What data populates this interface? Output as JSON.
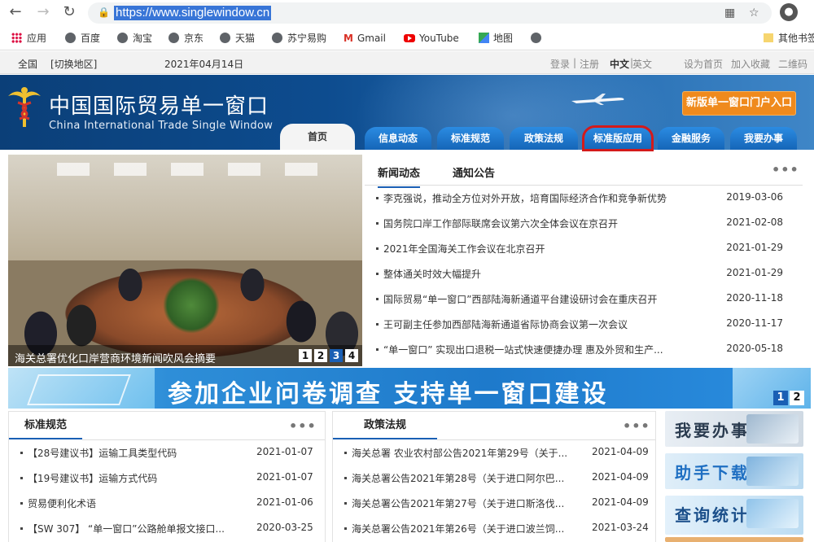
{
  "browser": {
    "url": "https://www.singlewindow.cn",
    "bookmarks": [
      {
        "label": "应用",
        "icon": "apps-grid-icon"
      },
      {
        "label": "百度",
        "icon": "globe-icon"
      },
      {
        "label": "淘宝",
        "icon": "globe-icon"
      },
      {
        "label": "京东",
        "icon": "globe-icon"
      },
      {
        "label": "天猫",
        "icon": "globe-icon"
      },
      {
        "label": "苏宁易购",
        "icon": "globe-icon"
      },
      {
        "label": "Gmail",
        "icon": "gmail-icon"
      },
      {
        "label": "YouTube",
        "icon": "youtube-icon"
      },
      {
        "label": "地图",
        "icon": "maps-icon"
      },
      {
        "label": "",
        "icon": "globe-icon"
      },
      {
        "label": "其他书签",
        "icon": "folder-icon"
      }
    ]
  },
  "topbar": {
    "region": "全国",
    "switch_region": "[切换地区]",
    "date": "2021年04月14日",
    "login": "登录",
    "sep1": "|",
    "register": "注册",
    "lang_cn": "中文",
    "lang_sep": "|",
    "lang_en": "英文",
    "set_home": "设为首页",
    "favorite": "加入收藏",
    "qrcode": "二维码"
  },
  "header": {
    "title_cn": "中国国际贸易单一窗口",
    "title_en": "China International Trade Single  Window",
    "new_portal": "新版单一窗口门户入口"
  },
  "nav": {
    "tabs": [
      "首页",
      "信息动态",
      "标准规范",
      "政策法规",
      "标准版应用",
      "金融服务",
      "我要办事"
    ]
  },
  "slideshow": {
    "caption": "海关总署优化口岸营商环境新闻吹风会摘要",
    "pages": [
      "1",
      "2",
      "3",
      "4"
    ],
    "active_page": "3"
  },
  "news": {
    "tabs": [
      "新闻动态",
      "通知公告"
    ],
    "more": "•••",
    "items": [
      {
        "title": "李克强说，推动全方位对外开放，培育国际经济合作和竞争新优势",
        "date": "2019-03-06"
      },
      {
        "title": "国务院口岸工作部际联席会议第六次全体会议在京召开",
        "date": "2021-02-08"
      },
      {
        "title": "2021年全国海关工作会议在北京召开",
        "date": "2021-01-29"
      },
      {
        "title": "整体通关时效大幅提升",
        "date": "2021-01-29"
      },
      {
        "title": "国际贸易“单一窗口”西部陆海新通道平台建设研讨会在重庆召开",
        "date": "2020-11-18"
      },
      {
        "title": "王可副主任参加西部陆海新通道省际协商会议第一次会议",
        "date": "2020-11-17"
      },
      {
        "title": "“单一窗口” 实现出口退税一站式快速便捷办理 惠及外贸和生产...",
        "date": "2020-05-18"
      }
    ]
  },
  "survey": {
    "text": "参加企业问卷调查   支持单一窗口建设",
    "pages": [
      "1",
      "2"
    ]
  },
  "standards": {
    "title": "标准规范",
    "more": "•••",
    "items": [
      {
        "title": "【28号建议书】运输工具类型代码",
        "date": "2021-01-07"
      },
      {
        "title": "【19号建议书】运输方式代码",
        "date": "2021-01-07"
      },
      {
        "title": "贸易便利化术语",
        "date": "2021-01-06"
      },
      {
        "title": "【SW 307】 “单一窗口”公路舱单报文接口...",
        "date": "2020-03-25"
      }
    ]
  },
  "policies": {
    "title": "政策法规",
    "more": "•••",
    "items": [
      {
        "title": "海关总署 农业农村部公告2021年第29号（关于...",
        "date": "2021-04-09"
      },
      {
        "title": "海关总署公告2021年第28号（关于进口阿尔巴...",
        "date": "2021-04-09"
      },
      {
        "title": "海关总署公告2021年第27号（关于进口斯洛伐...",
        "date": "2021-04-09"
      },
      {
        "title": "海关总署公告2021年第26号（关于进口波兰饲...",
        "date": "2021-03-24"
      }
    ]
  },
  "quick": {
    "items": [
      "我要办事",
      "助手下载",
      "查询统计"
    ]
  }
}
